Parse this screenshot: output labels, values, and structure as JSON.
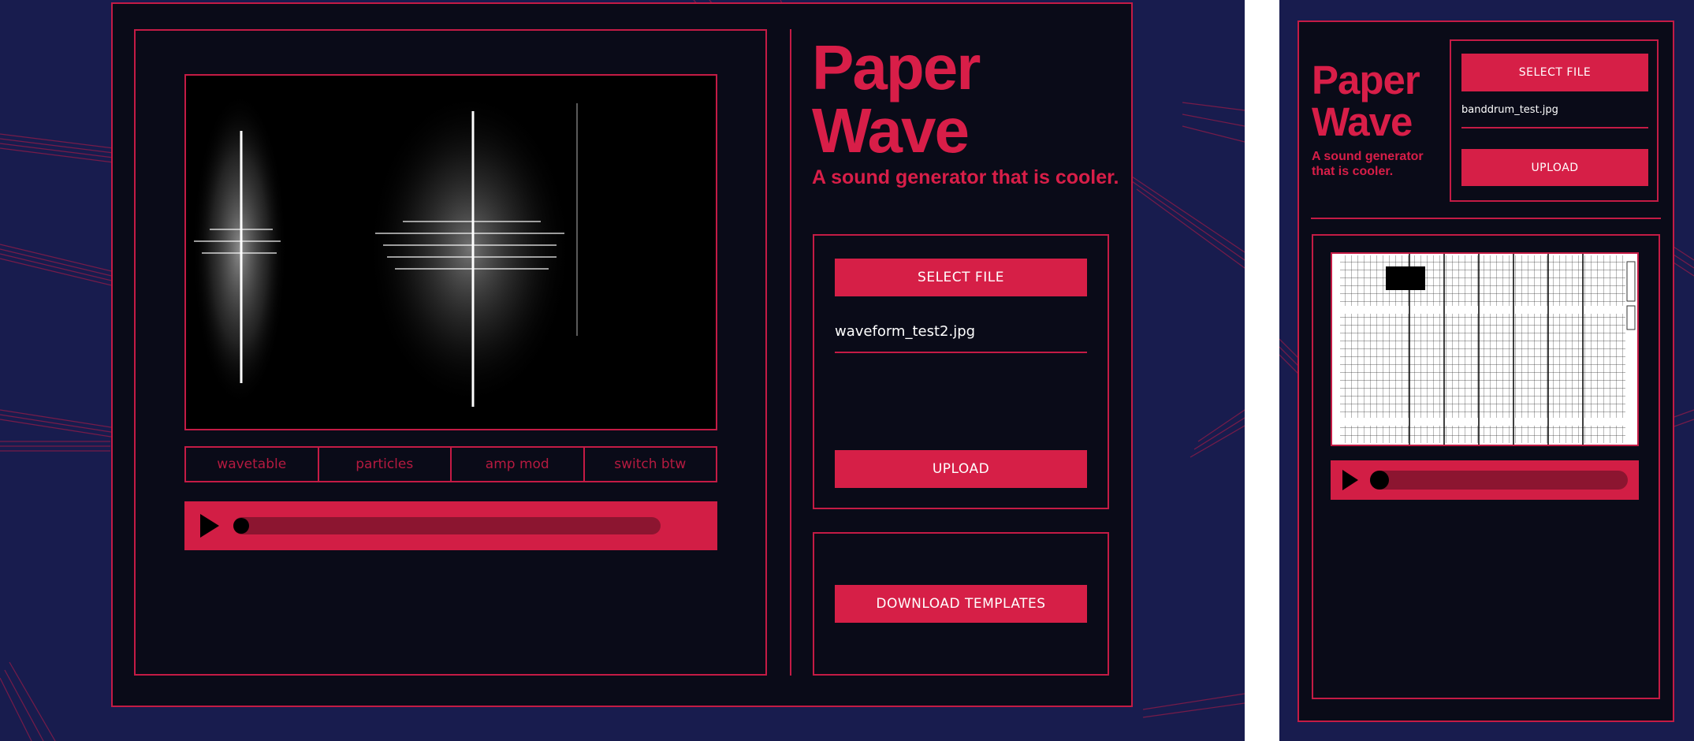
{
  "app": {
    "title_line1": "Paper",
    "title_line2": "Wave",
    "tagline": "A sound generator that is cooler."
  },
  "colors": {
    "accent": "#d61f47",
    "background": "#181c4e",
    "panel": "#0a0b18",
    "track": "#8c1530"
  },
  "desktop": {
    "select_label": "SELECT FILE",
    "filename": "waveform_test2.jpg",
    "upload_label": "UPLOAD",
    "download_label": "DOWNLOAD TEMPLATES",
    "tabs": [
      {
        "label": "wavetable"
      },
      {
        "label": "particles"
      },
      {
        "label": "amp mod"
      },
      {
        "label": "switch btw"
      }
    ],
    "playback_progress": 0.0,
    "play_icon": "play-icon"
  },
  "mobile": {
    "title_line1": "Paper",
    "title_line2": "Wave",
    "tagline_line1": "A sound generator",
    "tagline_line2": "that is cooler.",
    "select_label": "SELECT FILE",
    "filename": "banddrum_test.jpg",
    "upload_label": "UPLOAD",
    "playback_progress": 0.0,
    "play_icon": "play-icon"
  }
}
